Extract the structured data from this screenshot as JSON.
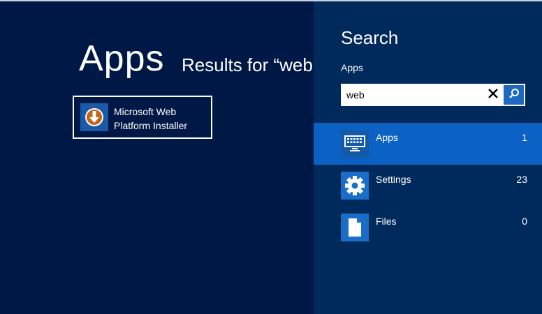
{
  "results_view": {
    "heading": "Apps",
    "subheading": "Results for “web”",
    "app_results": [
      {
        "name_line1": "Microsoft Web",
        "name_line2": "Platform Installer",
        "icon": "download-arrow-icon"
      }
    ]
  },
  "search_pane": {
    "title": "Search",
    "scope": "Apps",
    "query": "web",
    "clear_icon": "close-icon",
    "search_icon": "magnifier-icon",
    "categories": [
      {
        "label": "Apps",
        "count": "1",
        "icon": "keyboard-icon",
        "selected": true
      },
      {
        "label": "Settings",
        "count": "23",
        "icon": "gear-icon",
        "selected": false
      },
      {
        "label": "Files",
        "count": "0",
        "icon": "document-icon",
        "selected": false
      }
    ]
  },
  "colors": {
    "background": "#001845",
    "pane_background": "#002a5c",
    "selected_item": "#0b62c4",
    "tile_icon": "#1a6ec8"
  }
}
